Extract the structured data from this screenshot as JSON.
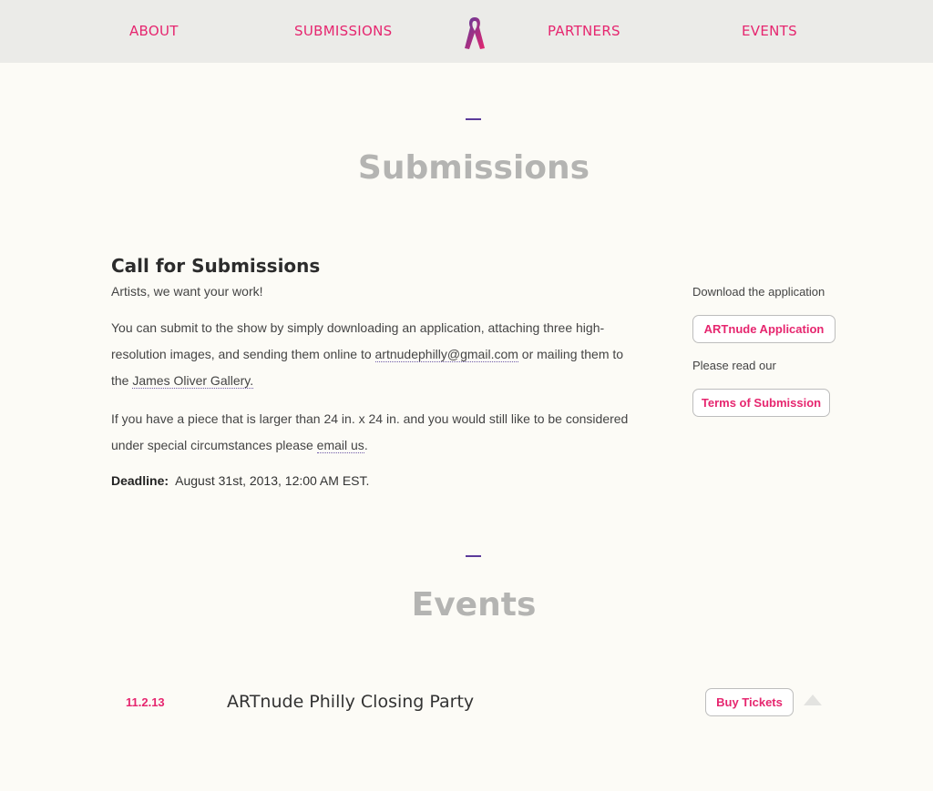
{
  "nav": {
    "items": [
      {
        "label": "ABOUT"
      },
      {
        "label": "SUBMISSIONS"
      },
      {
        "label": "PARTNERS"
      },
      {
        "label": "EVENTS"
      }
    ],
    "logo_icon": "awareness-ribbon-icon"
  },
  "submissions": {
    "title": "Submissions",
    "call_title": "Call for Submissions",
    "call_subtitle": "Artists, we want your work!",
    "para1_a": "You can submit to the show by simply downloading an application, attaching three high-resolution images, and sending them online to ",
    "para1_email": "artnudephilly@gmail.com",
    "para1_b": " or mailing them to the ",
    "para1_gallery": "James Oliver Gallery.",
    "para2_a": "If you have a piece that is larger than 24 in. x 24 in. and you would still like to be considered under special circumstances please ",
    "para2_link": "email us",
    "para2_b": ".",
    "deadline_label": "Deadline:",
    "deadline_value": "August 31st, 2013,  12:00 AM EST."
  },
  "sidebar": {
    "download_label": "Download the application",
    "application_button": "ARTnude Application",
    "read_label": "Please read our",
    "terms_button": "Terms of Submission"
  },
  "events": {
    "title": "Events",
    "items": [
      {
        "date": "11.2.13",
        "name": "ARTnude Philly Closing Party",
        "button": "Buy Tickets"
      }
    ]
  },
  "colors": {
    "accent": "#e6266f",
    "purple": "#5b3a9a",
    "heading_grey": "#b4b4b2",
    "nav_bg": "#ebebe8",
    "page_bg": "#fcfbf6"
  }
}
